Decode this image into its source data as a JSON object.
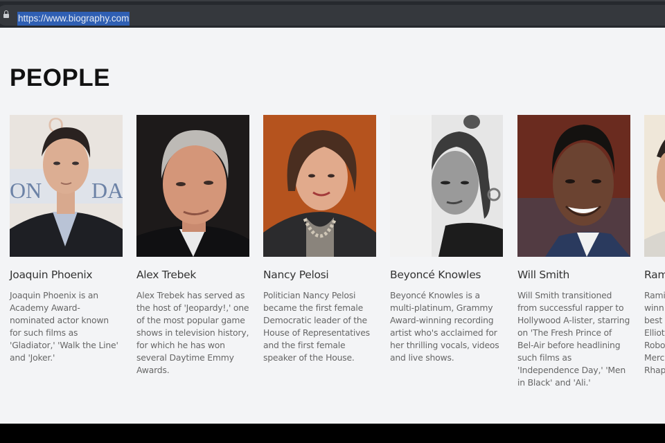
{
  "browser": {
    "url": "https://www.biography.com"
  },
  "section": {
    "title": "PEOPLE"
  },
  "people": [
    {
      "name": "Joaquin Phoenix",
      "description": "Joaquin Phoenix is an Academy Award-nominated actor known for such films as 'Gladiator,' 'Walk the Line' and 'Joker.'"
    },
    {
      "name": "Alex Trebek",
      "description": "Alex Trebek has served as the host of 'Jeopardy!,' one of the most popular game shows in television history, for which he has won several Daytime Emmy Awards."
    },
    {
      "name": "Nancy Pelosi",
      "description": "Politician Nancy Pelosi became the first female Democratic leader of the House of Representatives and the first female speaker of the House."
    },
    {
      "name": "Beyoncé Knowles",
      "description": "Beyoncé Knowles is a multi-platinum, Grammy Award-winning recording artist who's acclaimed for her thrilling vocals, videos and live shows."
    },
    {
      "name": "Will Smith",
      "description": "Will Smith transitioned from successful rapper to Hollywood A-lister, starring on 'The Fresh Prince of Bel-Air before headlining such films as 'Independence Day,' 'Men in Black' and 'Ali.'"
    },
    {
      "name": "Rami",
      "description": "Rami winn best Elliot Robo Merc Rhap"
    }
  ],
  "colors": {
    "page_background": "#f3f4f6",
    "browser_chrome": "#26292e",
    "url_selection": "#2f5fb3"
  }
}
